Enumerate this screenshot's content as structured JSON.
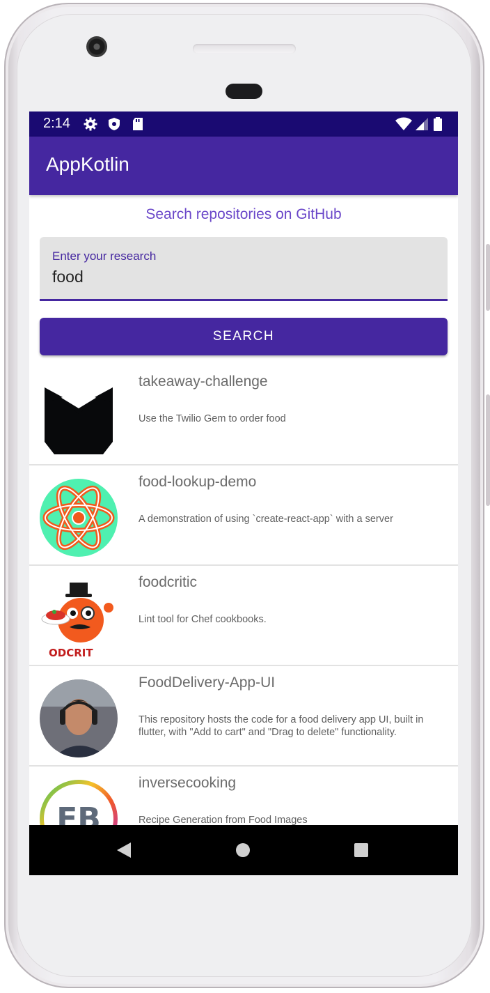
{
  "status_bar": {
    "time": "2:14",
    "left_icons": [
      "gear-icon",
      "shield-icon",
      "sd-card-icon"
    ],
    "right_icons": [
      "wifi-icon",
      "signal-icon",
      "battery-icon"
    ],
    "background": "#1a0a72"
  },
  "app_bar": {
    "title": "AppKotlin",
    "color": "#4527a0"
  },
  "main": {
    "heading": "Search repositories on GitHub",
    "search_field": {
      "label": "Enter your research",
      "value": "food"
    },
    "search_button": "SEARCH"
  },
  "repositories": [
    {
      "name": "takeaway-challenge",
      "description": "Use the Twilio Gem to order food",
      "avatar": "black-cat-shape-icon"
    },
    {
      "name": "food-lookup-demo",
      "description": "A demonstration of using `create-react-app` with a server",
      "avatar": "react-atom-icon"
    },
    {
      "name": "foodcritic",
      "description": "Lint tool for Chef cookbooks.",
      "avatar": "foodcritic-mascot",
      "avatar_text": "ODCRIT"
    },
    {
      "name": "FoodDelivery-App-UI",
      "description": "This repository hosts the code for a food delivery app UI, built in flutter, with \"Add to cart\" and \"Drag to delete\" functionality.",
      "avatar": "user-photo"
    },
    {
      "name": "inversecooking",
      "description": "Recipe Generation from Food Images",
      "avatar": "fb-logo",
      "avatar_text": "FB"
    }
  ],
  "nav_bar": {
    "buttons": [
      "back-icon",
      "home-icon",
      "recents-icon"
    ]
  }
}
